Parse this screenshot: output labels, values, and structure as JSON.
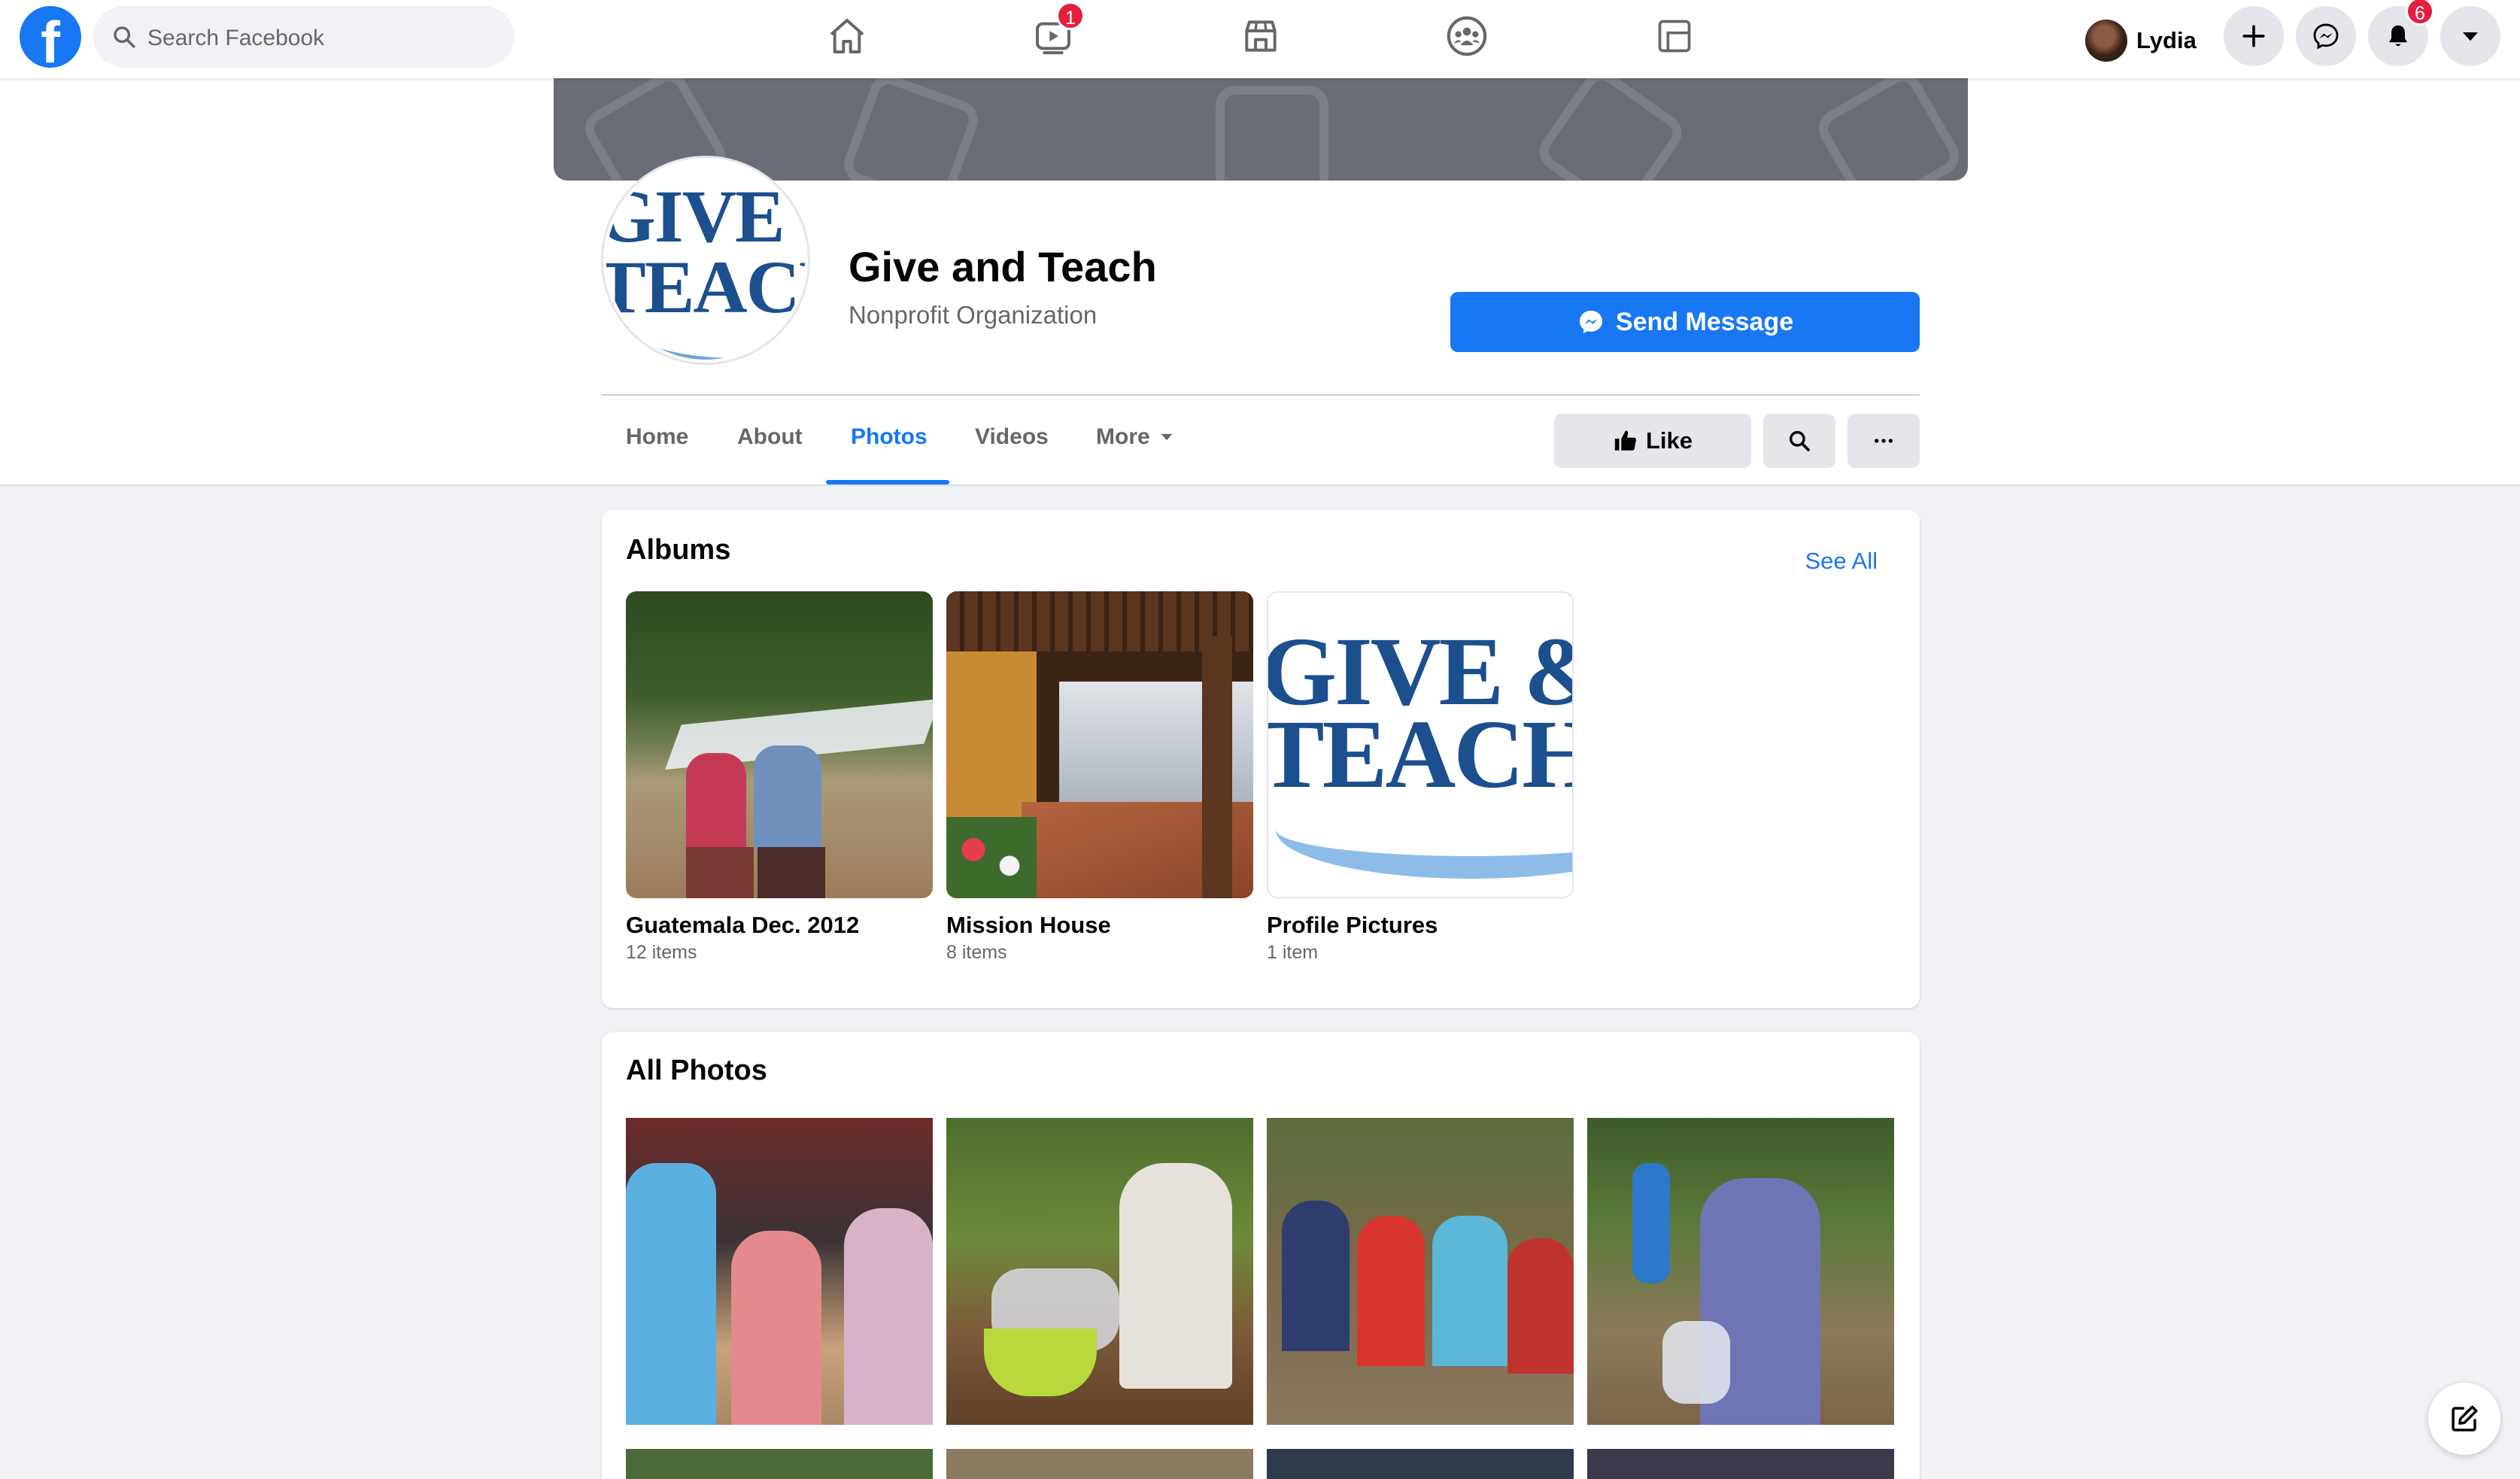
{
  "topnav": {
    "search_placeholder": "Search Facebook",
    "watch_badge": "1",
    "notifications_badge": "6",
    "user_name": "Lydia"
  },
  "page": {
    "name": "Give and Teach",
    "category": "Nonprofit Organization",
    "send_message_label": "Send Message",
    "like_label": "Like"
  },
  "tabs": [
    {
      "label": "Home"
    },
    {
      "label": "About"
    },
    {
      "label": "Photos"
    },
    {
      "label": "Videos"
    },
    {
      "label": "More"
    }
  ],
  "albums": {
    "title": "Albums",
    "see_all": "See All",
    "items": [
      {
        "name": "Guatemala Dec. 2012",
        "count": "12 items"
      },
      {
        "name": "Mission House",
        "count": "8 items"
      },
      {
        "name": "Profile Pictures",
        "count": "1 item"
      }
    ]
  },
  "all_photos": {
    "title": "All Photos"
  },
  "logo": {
    "line1": "GIVE &",
    "line2": "TEACH"
  },
  "colors": {
    "brand": "#1877f2",
    "badge": "#e41e3f",
    "logo_navy": "#1c4f8d"
  }
}
